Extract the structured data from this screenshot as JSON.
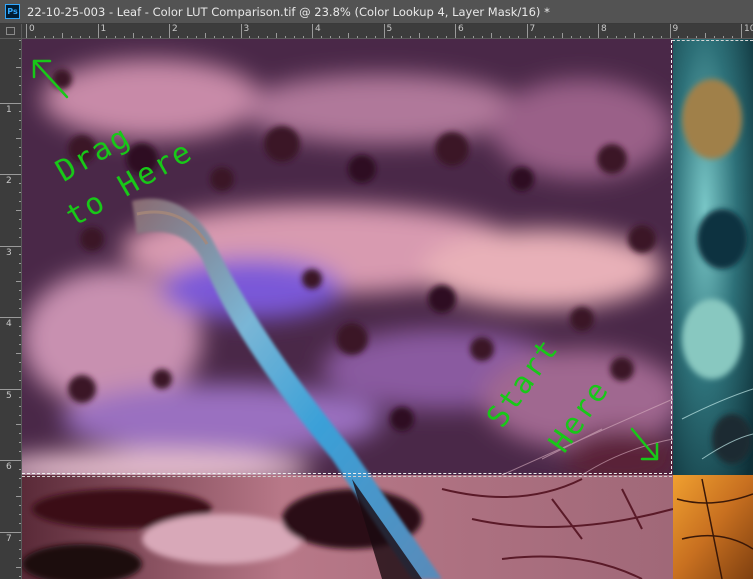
{
  "app": {
    "logo_text": "Ps",
    "document_title": "22-10-25-003 - Leaf - Color LUT Comparison.tif @ 23.8% (Color Lookup 4, Layer Mask/16) *",
    "close_glyph": "×"
  },
  "rulers": {
    "top_labels": [
      "0",
      "1",
      "2",
      "3",
      "4",
      "5",
      "6",
      "7",
      "8",
      "9",
      "10"
    ],
    "left_labels": [
      "1",
      "2",
      "3",
      "4",
      "5",
      "6",
      "7"
    ]
  },
  "annotations": {
    "drag_line1": "Drag",
    "drag_line2": "to Here",
    "start_line1": "Start",
    "start_line2": "Here",
    "color": "#18c818"
  },
  "colors": {
    "purple_region": "#4a2848",
    "teal_region": "#2d7078",
    "orange_region": "#d0802a",
    "marquee": "#f0f0f0"
  }
}
